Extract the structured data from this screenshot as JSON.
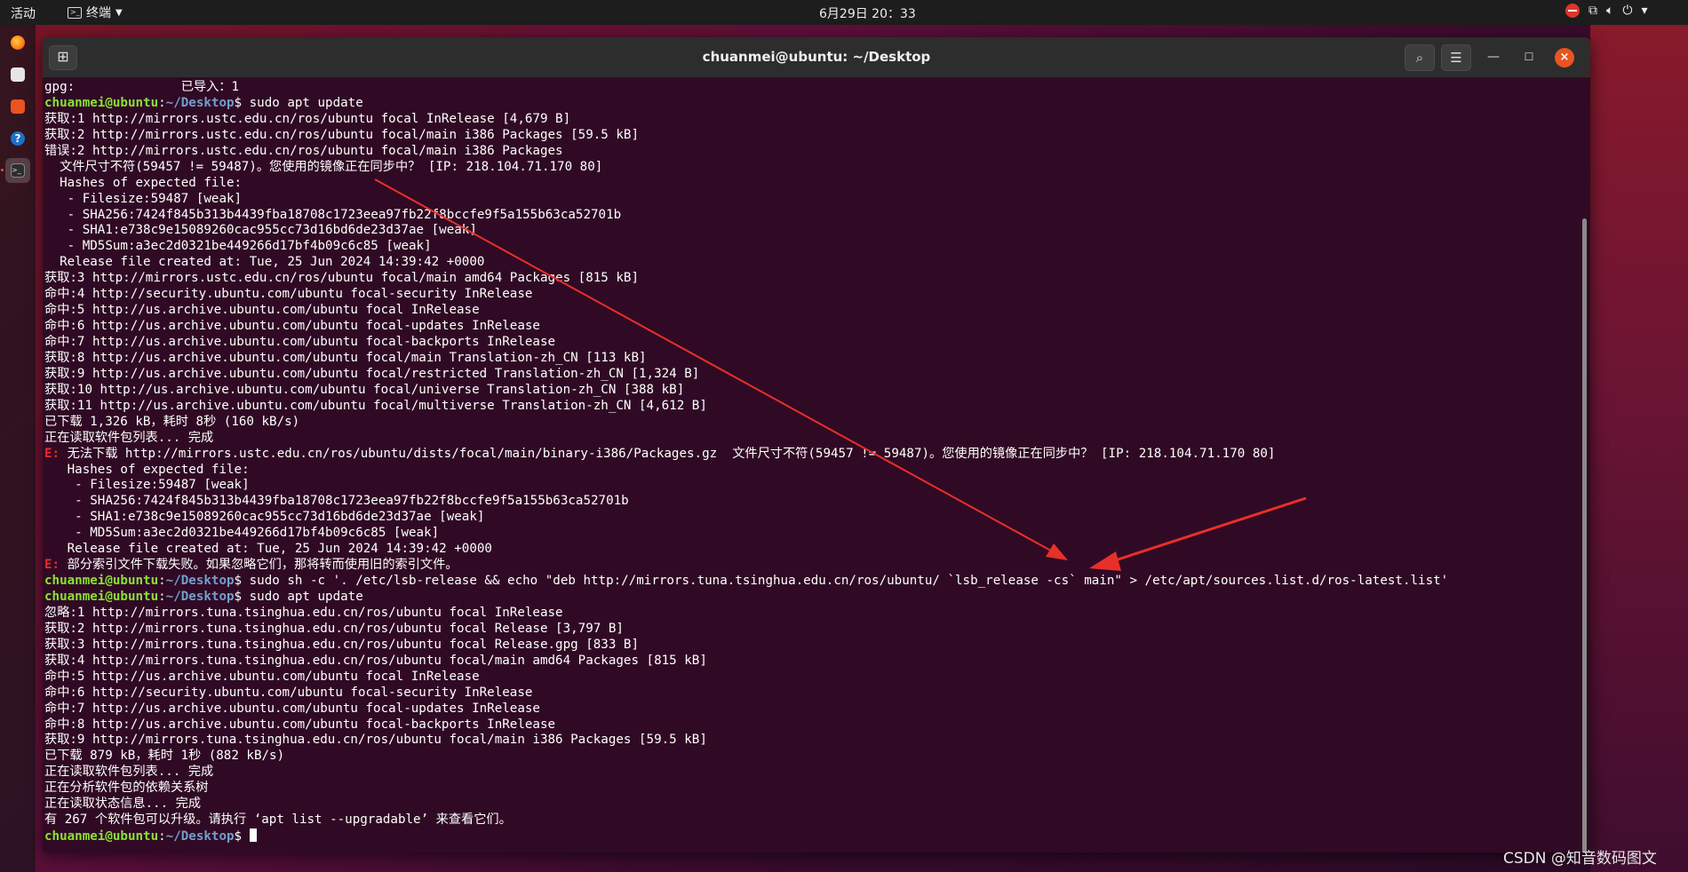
{
  "topbar": {
    "activities": "活动",
    "app_menu": "终端",
    "clock": "6月29日 20：33"
  },
  "dock": {
    "items": [
      "firefox-icon",
      "files-icon",
      "software-icon",
      "help-icon",
      "terminal-icon"
    ]
  },
  "window": {
    "title": "chuanmei@ubuntu: ~/Desktop"
  },
  "terminal": {
    "prompt_user": "chuanmei@ubuntu",
    "prompt_sep": ":",
    "prompt_path": "~/Desktop",
    "prompt_dollar": "$ ",
    "lines": [
      {
        "t": "plain",
        "text": "gpg:              已导入：1"
      },
      {
        "t": "prompt",
        "cmd": "sudo apt update"
      },
      {
        "t": "plain",
        "text": "获取:1 http://mirrors.ustc.edu.cn/ros/ubuntu focal InRelease [4,679 B]"
      },
      {
        "t": "plain",
        "text": "获取:2 http://mirrors.ustc.edu.cn/ros/ubuntu focal/main i386 Packages [59.5 kB]"
      },
      {
        "t": "plain",
        "text": "错误:2 http://mirrors.ustc.edu.cn/ros/ubuntu focal/main i386 Packages"
      },
      {
        "t": "plain",
        "text": "  文件尺寸不符(59457 != 59487)。您使用的镜像正在同步中？ [IP: 218.104.71.170 80]"
      },
      {
        "t": "plain",
        "text": "  Hashes of expected file:"
      },
      {
        "t": "plain",
        "text": "   - Filesize:59487 [weak]"
      },
      {
        "t": "plain",
        "text": "   - SHA256:7424f845b313b4439fba18708c1723eea97fb22f8bccfe9f5a155b63ca52701b"
      },
      {
        "t": "plain",
        "text": "   - SHA1:e738c9e15089260cac955cc73d16bd6de23d37ae [weak]"
      },
      {
        "t": "plain",
        "text": "   - MD5Sum:a3ec2d0321be449266d17bf4b09c6c85 [weak]"
      },
      {
        "t": "plain",
        "text": "  Release file created at: Tue, 25 Jun 2024 14:39:42 +0000"
      },
      {
        "t": "plain",
        "text": "获取:3 http://mirrors.ustc.edu.cn/ros/ubuntu focal/main amd64 Packages [815 kB]"
      },
      {
        "t": "plain",
        "text": "命中:4 http://security.ubuntu.com/ubuntu focal-security InRelease"
      },
      {
        "t": "plain",
        "text": "命中:5 http://us.archive.ubuntu.com/ubuntu focal InRelease"
      },
      {
        "t": "plain",
        "text": "命中:6 http://us.archive.ubuntu.com/ubuntu focal-updates InRelease"
      },
      {
        "t": "plain",
        "text": "命中:7 http://us.archive.ubuntu.com/ubuntu focal-backports InRelease"
      },
      {
        "t": "plain",
        "text": "获取:8 http://us.archive.ubuntu.com/ubuntu focal/main Translation-zh_CN [113 kB]"
      },
      {
        "t": "plain",
        "text": "获取:9 http://us.archive.ubuntu.com/ubuntu focal/restricted Translation-zh_CN [1,324 B]"
      },
      {
        "t": "plain",
        "text": "获取:10 http://us.archive.ubuntu.com/ubuntu focal/universe Translation-zh_CN [388 kB]"
      },
      {
        "t": "plain",
        "text": "获取:11 http://us.archive.ubuntu.com/ubuntu focal/multiverse Translation-zh_CN [4,612 B]"
      },
      {
        "t": "plain",
        "text": "已下载 1,326 kB，耗时 8秒 (160 kB/s)"
      },
      {
        "t": "plain",
        "text": "正在读取软件包列表... 完成"
      },
      {
        "t": "error",
        "tag": "E: ",
        "text": "无法下载 http://mirrors.ustc.edu.cn/ros/ubuntu/dists/focal/main/binary-i386/Packages.gz  文件尺寸不符(59457 != 59487)。您使用的镜像正在同步中？ [IP: 218.104.71.170 80]"
      },
      {
        "t": "plain",
        "text": "   Hashes of expected file:"
      },
      {
        "t": "plain",
        "text": "    - Filesize:59487 [weak]"
      },
      {
        "t": "plain",
        "text": "    - SHA256:7424f845b313b4439fba18708c1723eea97fb22f8bccfe9f5a155b63ca52701b"
      },
      {
        "t": "plain",
        "text": "    - SHA1:e738c9e15089260cac955cc73d16bd6de23d37ae [weak]"
      },
      {
        "t": "plain",
        "text": "    - MD5Sum:a3ec2d0321be449266d17bf4b09c6c85 [weak]"
      },
      {
        "t": "plain",
        "text": "   Release file created at: Tue, 25 Jun 2024 14:39:42 +0000"
      },
      {
        "t": "error",
        "tag": "E: ",
        "text": "部分索引文件下载失败。如果忽略它们，那将转而使用旧的索引文件。"
      },
      {
        "t": "prompt",
        "cmd": "sudo sh -c '. /etc/lsb-release && echo \"deb http://mirrors.tuna.tsinghua.edu.cn/ros/ubuntu/ `lsb_release -cs` main\" > /etc/apt/sources.list.d/ros-latest.list'"
      },
      {
        "t": "prompt",
        "cmd": "sudo apt update"
      },
      {
        "t": "plain",
        "text": "忽略:1 http://mirrors.tuna.tsinghua.edu.cn/ros/ubuntu focal InRelease"
      },
      {
        "t": "plain",
        "text": "获取:2 http://mirrors.tuna.tsinghua.edu.cn/ros/ubuntu focal Release [3,797 B]"
      },
      {
        "t": "plain",
        "text": "获取:3 http://mirrors.tuna.tsinghua.edu.cn/ros/ubuntu focal Release.gpg [833 B]"
      },
      {
        "t": "plain",
        "text": "获取:4 http://mirrors.tuna.tsinghua.edu.cn/ros/ubuntu focal/main amd64 Packages [815 kB]"
      },
      {
        "t": "plain",
        "text": "命中:5 http://us.archive.ubuntu.com/ubuntu focal InRelease"
      },
      {
        "t": "plain",
        "text": "命中:6 http://security.ubuntu.com/ubuntu focal-security InRelease"
      },
      {
        "t": "plain",
        "text": "命中:7 http://us.archive.ubuntu.com/ubuntu focal-updates InRelease"
      },
      {
        "t": "plain",
        "text": "命中:8 http://us.archive.ubuntu.com/ubuntu focal-backports InRelease"
      },
      {
        "t": "plain",
        "text": "获取:9 http://mirrors.tuna.tsinghua.edu.cn/ros/ubuntu focal/main i386 Packages [59.5 kB]"
      },
      {
        "t": "plain",
        "text": "已下载 879 kB，耗时 1秒 (882 kB/s)"
      },
      {
        "t": "plain",
        "text": "正在读取软件包列表... 完成"
      },
      {
        "t": "plain",
        "text": "正在分析软件包的依赖关系树"
      },
      {
        "t": "plain",
        "text": "正在读取状态信息... 完成"
      },
      {
        "t": "plain",
        "text": "有 267 个软件包可以升级。请执行 ‘apt list --upgradable’ 来查看它们。"
      },
      {
        "t": "prompt",
        "cmd": ""
      }
    ]
  },
  "colors": {
    "terminal_bg": "#300a24",
    "prompt_user": "#8ae234",
    "prompt_path": "#729fcf",
    "error": "#ef2929",
    "annotation_arrow": "#e8302a",
    "close_button": "#e95420"
  },
  "watermark": "CSDN @知音数码图文"
}
